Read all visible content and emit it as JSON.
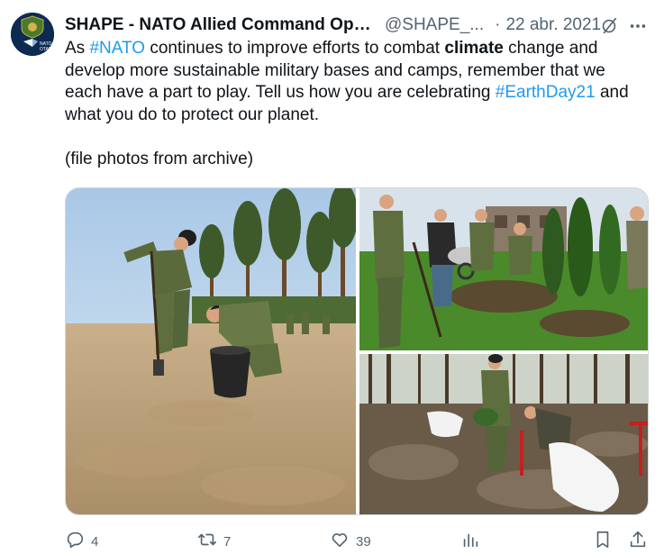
{
  "author": {
    "name": "SHAPE - NATO Allied Command Ope...",
    "handle": "@SHAPE_...",
    "separator": "·",
    "date": "22 abr. 2021",
    "avatar_text": "NATO\nOTAN",
    "avatar_line1": "NATO",
    "avatar_line2": "OTAN"
  },
  "tweet": {
    "t1": "As ",
    "hashtag1": "#NATO",
    "t2": " continues to improve efforts to combat ",
    "bold_word": "climate",
    "t3": " change and develop more sustainable military bases and camps, remember that we each have a part to play. Tell us how you are celebrating ",
    "hashtag2": "#EarthDay21",
    "t4": " and what you do to protect our planet.",
    "note": "(file photos from archive)"
  },
  "media": {
    "photos": [
      "tree-planting-photo-soldiers-digging",
      "tree-planting-photo-group-garden",
      "tree-planting-photo-forest-clearing"
    ]
  },
  "actions": {
    "reply_count": "4",
    "retweet_count": "7",
    "like_count": "39"
  },
  "icons": {
    "grok": "grok-icon",
    "more": "more-icon",
    "reply": "reply-icon",
    "retweet": "retweet-icon",
    "like": "heart-icon",
    "views": "views-icon",
    "bookmark": "bookmark-icon",
    "share": "share-icon"
  },
  "colors": {
    "link": "#1d9bf0",
    "muted": "#536471",
    "text": "#0f1419",
    "avatar_bg": "#0c2a52"
  }
}
